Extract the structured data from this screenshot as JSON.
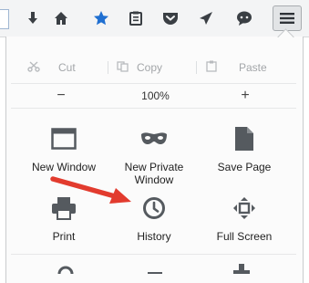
{
  "toolbar": {
    "buttons": [
      {
        "name": "downloads-button",
        "icon": "download-arrow-icon"
      },
      {
        "name": "home-button",
        "icon": "home-icon"
      },
      {
        "name": "bookmark-button",
        "icon": "star-icon"
      },
      {
        "name": "bookmarks-menu-button",
        "icon": "clipboard-icon"
      },
      {
        "name": "pocket-button",
        "icon": "pocket-icon"
      },
      {
        "name": "send-button",
        "icon": "send-arrow-icon"
      },
      {
        "name": "chat-button",
        "icon": "chat-bubble-icon"
      },
      {
        "name": "menu-button",
        "icon": "hamburger-menu-icon"
      }
    ]
  },
  "panel": {
    "edit": {
      "cut": "Cut",
      "copy": "Copy",
      "paste": "Paste"
    },
    "zoom": {
      "minus": "−",
      "level": "100%",
      "plus": "+"
    },
    "tiles": [
      {
        "label": "New Window",
        "icon": "window-icon"
      },
      {
        "label": "New Private Window",
        "icon": "mask-icon"
      },
      {
        "label": "Save Page",
        "icon": "page-icon"
      },
      {
        "label": "Print",
        "icon": "printer-icon"
      },
      {
        "label": "History",
        "icon": "clock-icon"
      },
      {
        "label": "Full Screen",
        "icon": "fullscreen-icon"
      }
    ]
  },
  "annotation": {
    "color": "#e23b2e"
  }
}
